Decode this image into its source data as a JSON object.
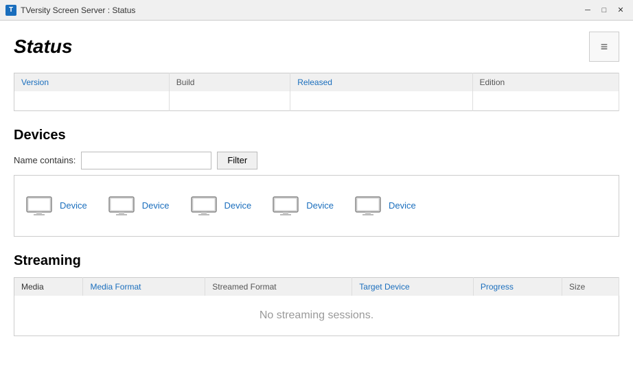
{
  "window": {
    "title": "TVersity Screen Server : Status",
    "icon": "T"
  },
  "titlebar": {
    "minimize_label": "─",
    "maximize_label": "□",
    "close_label": "✕"
  },
  "page": {
    "title": "Status",
    "menu_icon": "≡"
  },
  "info_table": {
    "headers": [
      "Version",
      "Build",
      "Released",
      "Edition"
    ],
    "row": [
      "",
      "",
      "",
      ""
    ]
  },
  "devices": {
    "section_title": "Devices",
    "filter_label": "Name contains:",
    "filter_placeholder": "",
    "filter_button": "Filter",
    "items": [
      {
        "name": "Device"
      },
      {
        "name": "Device"
      },
      {
        "name": "Device"
      },
      {
        "name": "Device"
      },
      {
        "name": "Device"
      }
    ]
  },
  "streaming": {
    "section_title": "Streaming",
    "table_headers": [
      "Media",
      "Media Format",
      "Streamed Format",
      "Target Device",
      "Progress",
      "Size"
    ],
    "no_sessions_text": "No streaming sessions."
  }
}
